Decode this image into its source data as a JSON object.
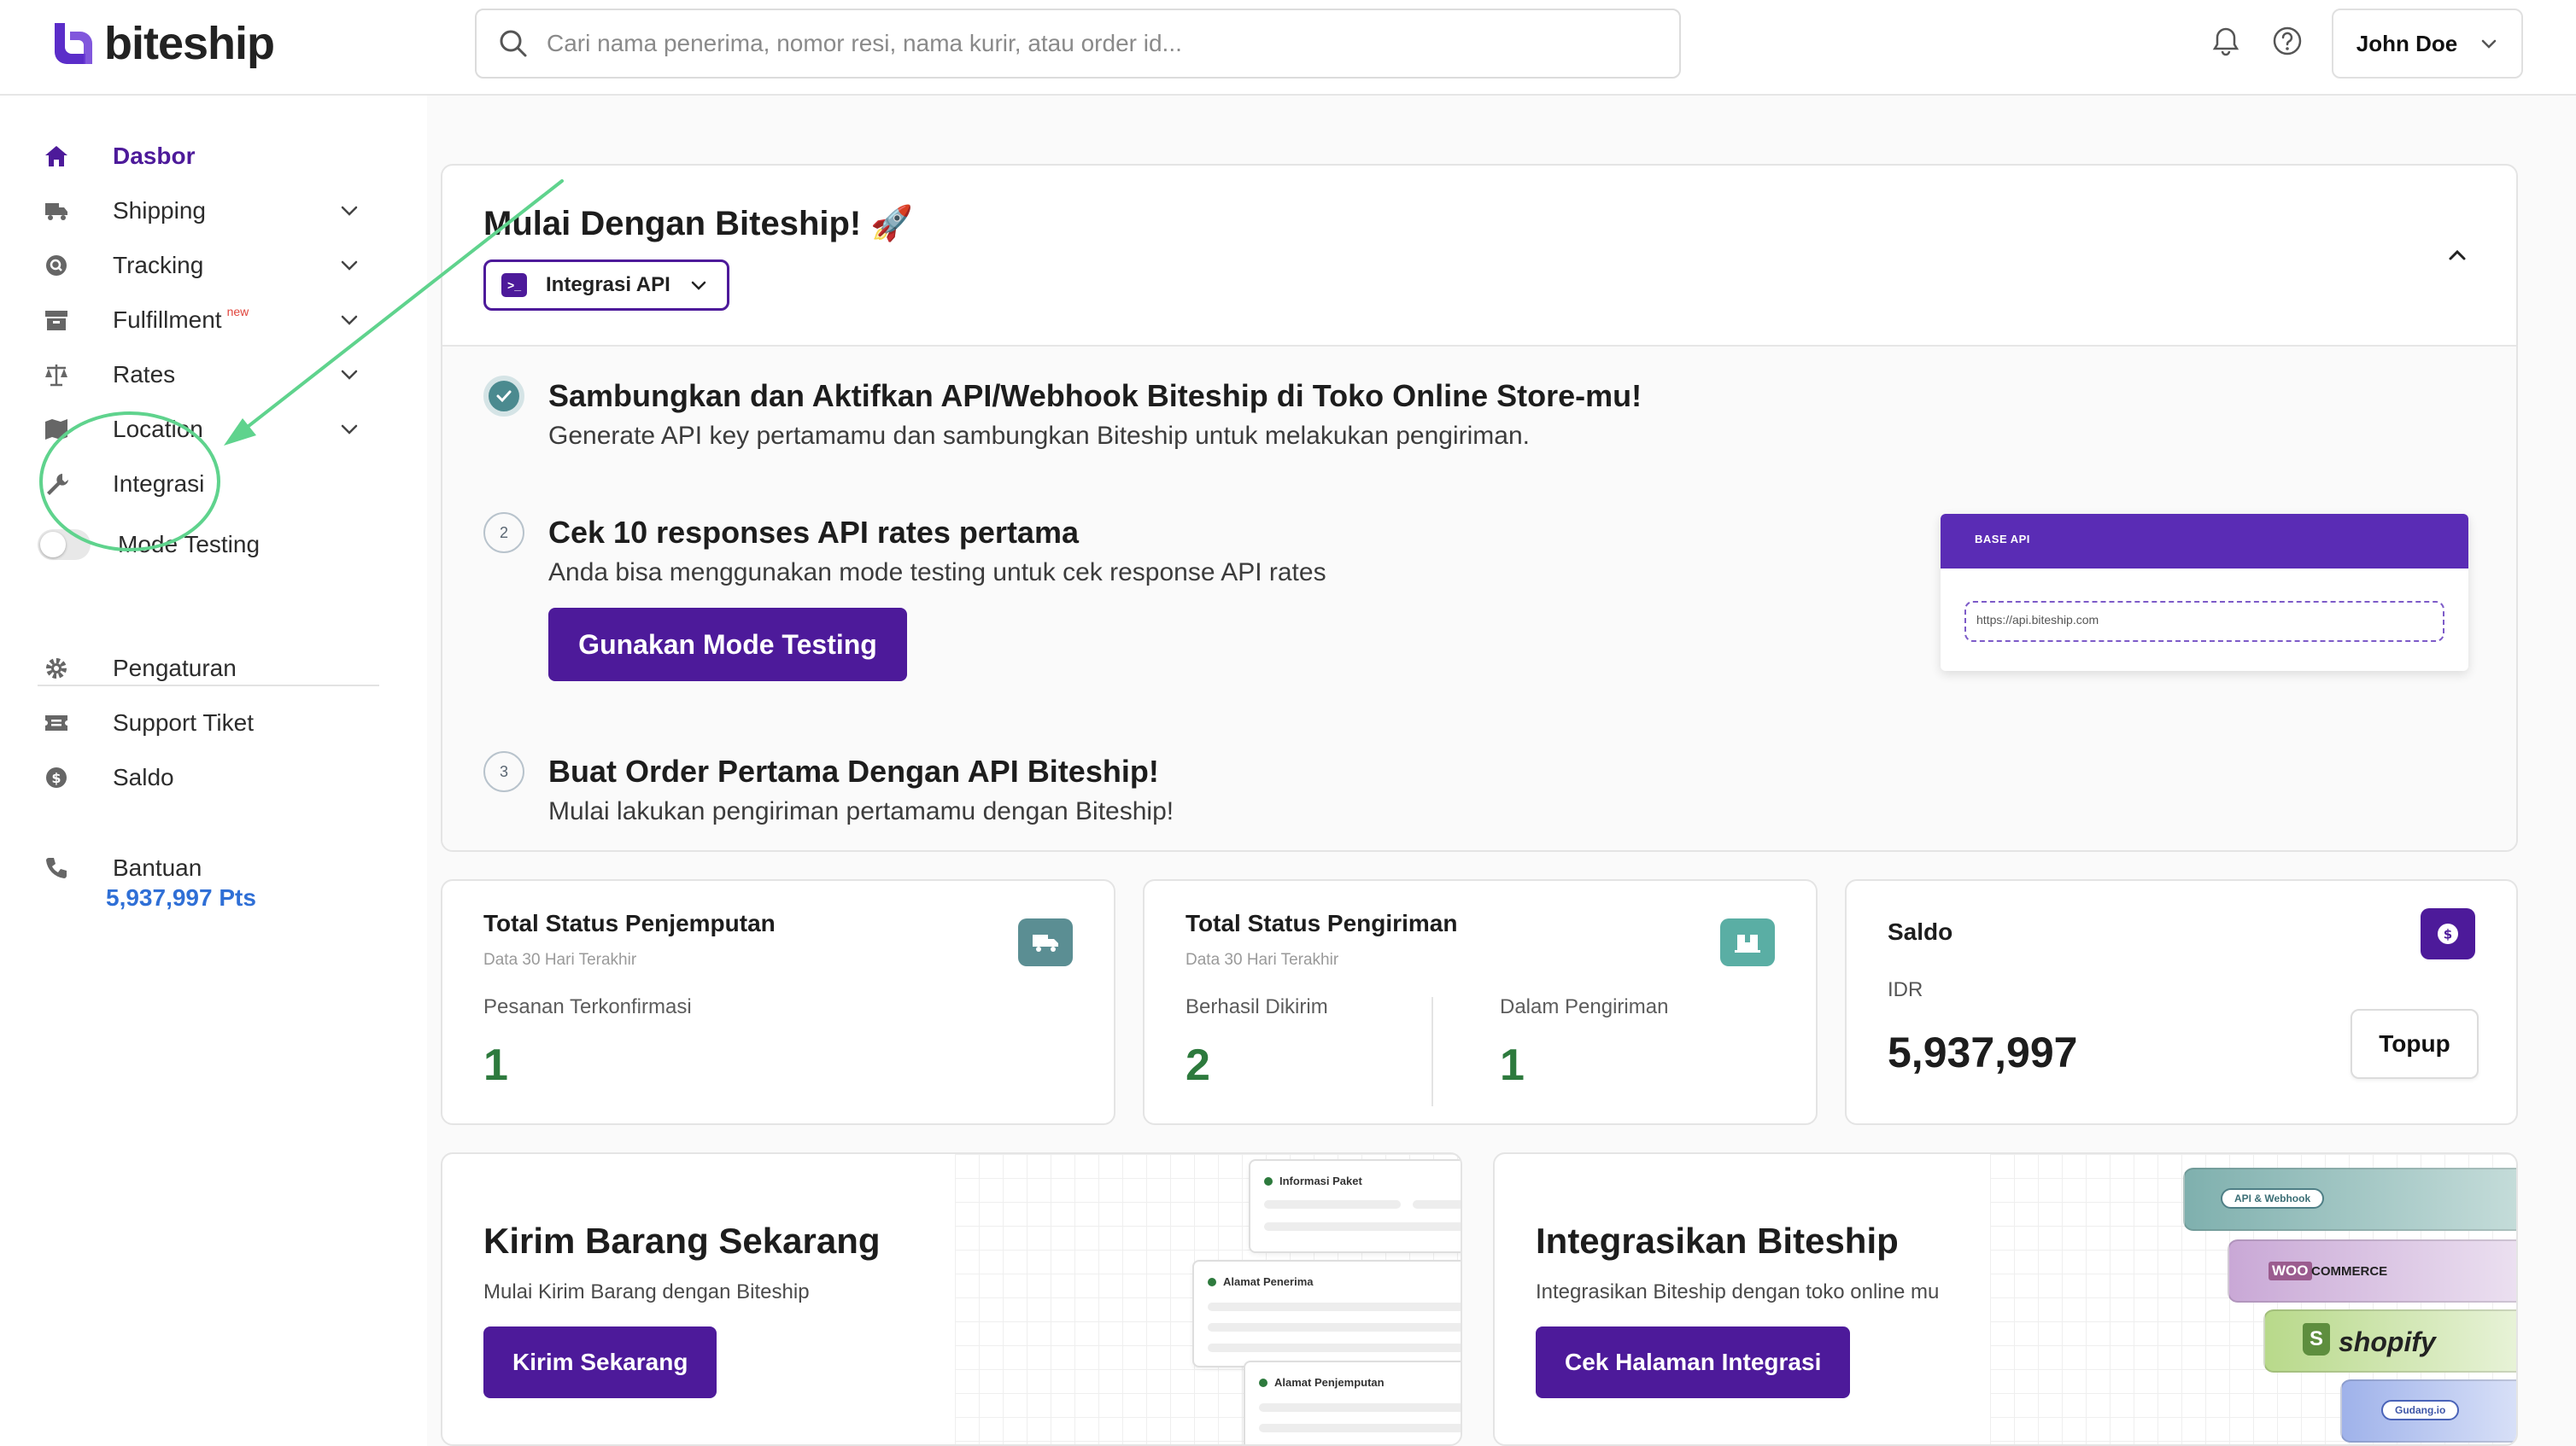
{
  "app": {
    "logo_text": "biteship"
  },
  "search": {
    "placeholder": "Cari nama penerima, nomor resi, nama kurir, atau order id..."
  },
  "user": {
    "name": "John Doe"
  },
  "sidebar": {
    "items": [
      {
        "label": "Dasbor",
        "icon": "home-icon",
        "active": true
      },
      {
        "label": "Shipping",
        "icon": "truck-icon",
        "has_chevron": true
      },
      {
        "label": "Tracking",
        "icon": "search-location-icon",
        "has_chevron": true
      },
      {
        "label": "Fulfillment",
        "icon": "box-icon",
        "has_chevron": true,
        "badge": "new"
      },
      {
        "label": "Rates",
        "icon": "scale-icon",
        "has_chevron": true
      },
      {
        "label": "Location",
        "icon": "map-icon",
        "has_chevron": true
      },
      {
        "label": "Integrasi",
        "icon": "wrench-icon"
      },
      {
        "label": "Mode Testing",
        "icon": "toggle-switch"
      },
      {
        "label": "Pengaturan",
        "icon": "gear-icon"
      },
      {
        "label": "Support Tiket",
        "icon": "ticket-icon"
      },
      {
        "label": "Saldo",
        "icon": "dollar-circle-icon"
      },
      {
        "label": "Bantuan",
        "icon": "phone-icon"
      }
    ],
    "points": "5,937,997 Pts"
  },
  "onboarding": {
    "title": "Mulai Dengan Biteship! 🚀",
    "select_label": "Integrasi API",
    "steps": [
      {
        "num": "",
        "title": "Sambungkan dan Aktifkan API/Webhook Biteship di Toko Online Store-mu!",
        "desc": "Generate API key pertamamu dan sambungkan Biteship untuk melakukan pengiriman.",
        "done": true
      },
      {
        "num": "2",
        "title": "Cek 10 responses API rates pertama",
        "desc": "Anda bisa menggunakan mode testing untuk cek response API rates",
        "button": "Gunakan Mode Testing"
      },
      {
        "num": "3",
        "title": "Buat Order Pertama Dengan API Biteship!",
        "desc": "Mulai lakukan pengiriman pertamamu dengan Biteship!"
      }
    ],
    "base_api": {
      "label": "BASE API",
      "url": "https://api.biteship.com"
    }
  },
  "stats": {
    "pickup": {
      "title": "Total Status Penjemputan",
      "subtitle": "Data 30 Hari Terakhir",
      "label": "Pesanan Terkonfirmasi",
      "value": "1"
    },
    "shipping": {
      "title": "Total Status Pengiriman",
      "subtitle": "Data 30 Hari Terakhir",
      "label_a": "Berhasil Dikirim",
      "value_a": "2",
      "label_b": "Dalam Pengiriman",
      "value_b": "1"
    },
    "balance": {
      "title": "Saldo",
      "currency": "IDR",
      "value": "5,937,997",
      "button": "Topup"
    }
  },
  "promo": {
    "send": {
      "title": "Kirim Barang Sekarang",
      "desc": "Mulai Kirim Barang dengan Biteship",
      "button": "Kirim Sekarang",
      "cards": [
        "Informasi Paket",
        "Alamat Penerima",
        "Alamat Penjemputan"
      ]
    },
    "integrate": {
      "title": "Integrasikan Biteship",
      "desc": "Integrasikan Biteship dengan toko online mu",
      "button": "Cek Halaman Integrasi",
      "tiles": [
        "API & Webhook",
        "WOO",
        "COMMERCE",
        "shopify",
        "Gudang.io"
      ]
    }
  },
  "colors": {
    "brand": "#4d1a9a",
    "accent_green": "#2d7a3d",
    "points_blue": "#2f6fd6",
    "annotation_green": "#5fd38d"
  }
}
